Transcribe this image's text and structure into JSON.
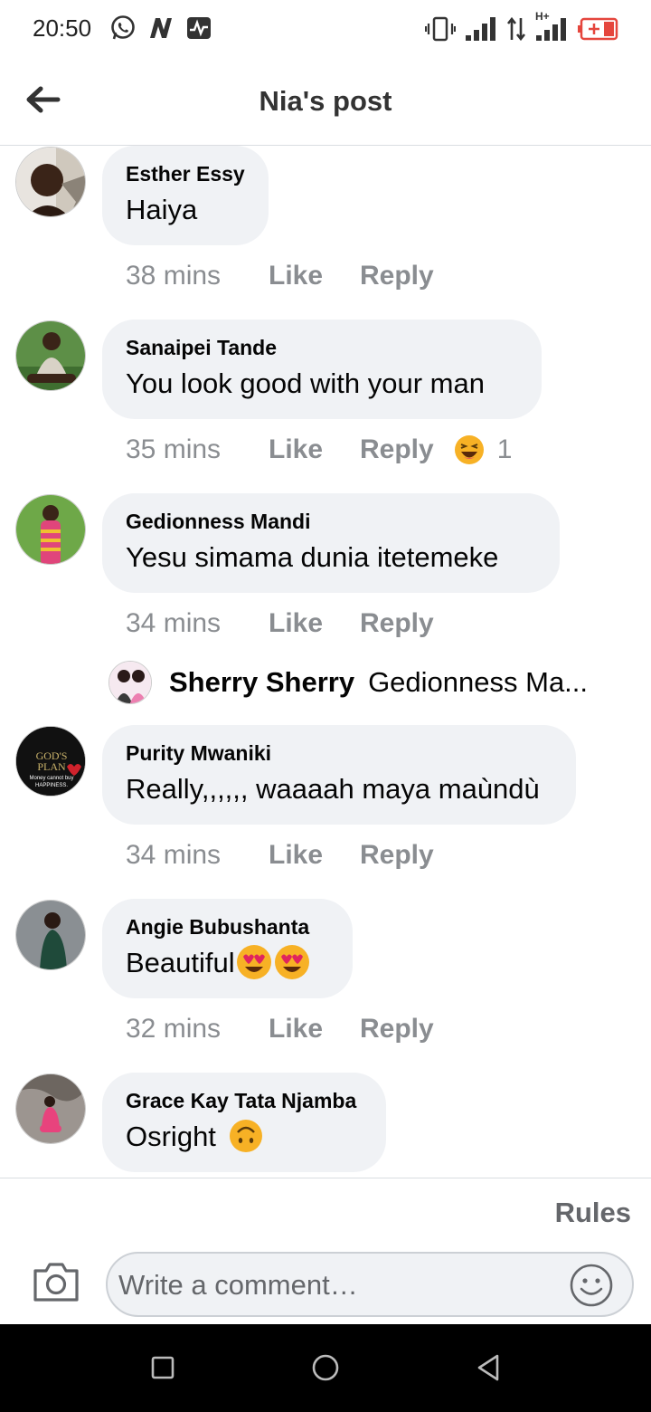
{
  "status_bar": {
    "time": "20:50",
    "icons_left": [
      "whatsapp-icon",
      "n-app-icon",
      "activity-icon"
    ],
    "icons_right": [
      "vibrate-icon",
      "signal-icon",
      "data-arrows-icon",
      "h-plus-signal-icon",
      "battery-charging-icon"
    ],
    "network_label": "H+"
  },
  "header": {
    "title": "Nia's post"
  },
  "comments": [
    {
      "name": "Esther Essy",
      "text": "Haiya",
      "time": "38 mins",
      "like": "Like",
      "reply": "Reply"
    },
    {
      "name": "Sanaipei Tande",
      "text": "You look good with your man",
      "time": "35 mins",
      "like": "Like",
      "reply": "Reply",
      "reaction": {
        "icon": "laughing-emoji-icon",
        "count": "1"
      }
    },
    {
      "name": "Gedionness Mandi",
      "text": "Yesu simama dunia itetemeke",
      "time": "34 mins",
      "like": "Like",
      "reply": "Reply",
      "reply_preview": {
        "name": "Sherry Sherry",
        "text": "Gedionness Ma..."
      }
    },
    {
      "name": "Purity Mwaniki",
      "text": "Really,,,,,, waaaah maya maùndù",
      "time": "34 mins",
      "like": "Like",
      "reply": "Reply",
      "avatar_text": [
        "GOD'S",
        "PLAN",
        "Money cannot buy",
        "HAPPINESS."
      ]
    },
    {
      "name": "Angie Bubushanta",
      "text": "Beautiful",
      "time": "32 mins",
      "like": "Like",
      "reply": "Reply",
      "trailing_emoji": [
        "heart-eyes-emoji-icon",
        "heart-eyes-emoji-icon"
      ]
    },
    {
      "name": "Grace Kay Tata Njamba",
      "text": "Osright",
      "trailing_emoji": [
        "upside-down-face-emoji-icon"
      ]
    }
  ],
  "footer": {
    "rules_label": "Rules",
    "comment_placeholder": "Write a comment…"
  },
  "colors": {
    "bubble": "#f0f2f5",
    "meta": "#8a8d91",
    "battery": "#e5463d"
  }
}
